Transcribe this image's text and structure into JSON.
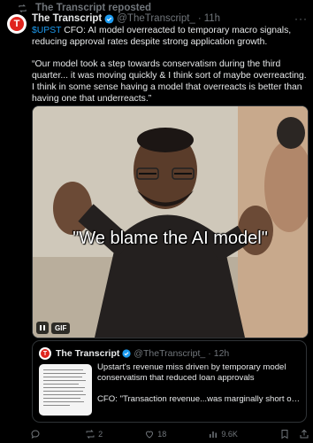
{
  "repost_banner": {
    "text": "The Transcript reposted"
  },
  "tweet": {
    "author_name": "The Transcript",
    "handle": "@TheTranscript_",
    "separator": "·",
    "time": "11h",
    "cashtag": "$UPST",
    "text_lead": " CFO: AI model overreacted to temporary macro signals, reducing approval rates despite strong application growth.",
    "quote_text": "“Our model took a step towards conservatism during the third quarter... it was moving quickly & I think sort of maybe overreacting. I think in some sense having a model that overreacts is better than having one that underreacts.”",
    "media": {
      "caption": "\"We blame the AI model\"",
      "gif_label": "GIF"
    }
  },
  "quoted_tweet": {
    "author_name": "The Transcript",
    "handle": "@TheTranscript_",
    "separator": "·",
    "time": "12h",
    "headline": "Upstart's revenue miss driven by temporary model conservatism that reduced loan approvals",
    "excerpt": "CFO: \"Transaction revenue...was marginally short of expectation as our models expressed some temporar..."
  },
  "actions": {
    "replies": "",
    "reposts": "2",
    "likes": "18",
    "views": "9.6K"
  },
  "colors": {
    "accent": "#1d9bf0",
    "brand_red": "#e0241e",
    "muted": "#71767b",
    "border": "#2f3336"
  },
  "icons": [
    "repost-icon",
    "verified-badge-icon",
    "more-icon",
    "pause-icon",
    "reply-icon",
    "repost-icon",
    "like-icon",
    "views-icon",
    "bookmark-icon",
    "share-icon"
  ]
}
